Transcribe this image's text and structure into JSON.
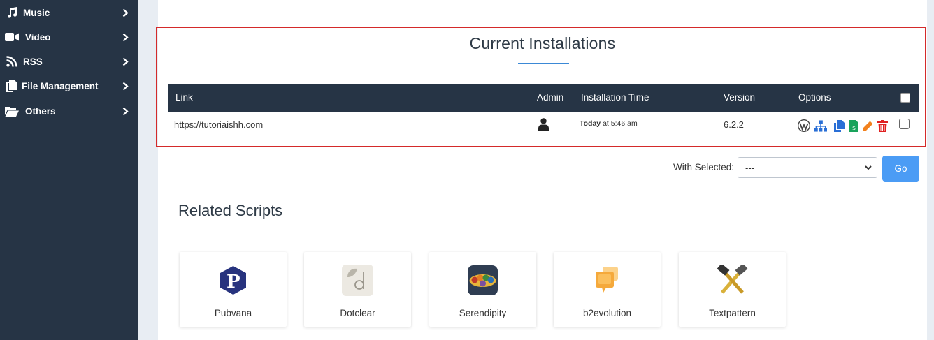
{
  "sidebar": {
    "items": [
      {
        "label": "Music",
        "icon": "music-note-icon"
      },
      {
        "label": "Video",
        "icon": "video-camera-icon"
      },
      {
        "label": "RSS",
        "icon": "rss-icon"
      },
      {
        "label": "File Management",
        "icon": "files-icon"
      },
      {
        "label": "Others",
        "icon": "folder-open-icon"
      }
    ]
  },
  "installations": {
    "title": "Current Installations",
    "columns": {
      "link": "Link",
      "admin": "Admin",
      "time": "Installation Time",
      "version": "Version",
      "options": "Options"
    },
    "rows": [
      {
        "link": "https://tutoriaishh.com",
        "time_day": "Today",
        "time_rest": " at 5:46 am",
        "version": "6.2.2"
      }
    ],
    "option_icons": [
      "wordpress-icon",
      "sitemap-icon",
      "copy-icon",
      "staging-file-icon",
      "edit-pencil-icon",
      "trash-icon"
    ]
  },
  "bulk": {
    "label": "With Selected:",
    "selected": "---",
    "go": "Go"
  },
  "related": {
    "title": "Related Scripts",
    "scripts": [
      "Pubvana",
      "Dotclear",
      "Serendipity",
      "b2evolution",
      "Textpattern"
    ]
  },
  "colors": {
    "sidebar_bg": "#263445",
    "table_header_bg": "#263445",
    "accent": "#3b89d6",
    "go_button": "#4b9cf5",
    "highlight_border": "#d42a2a"
  }
}
